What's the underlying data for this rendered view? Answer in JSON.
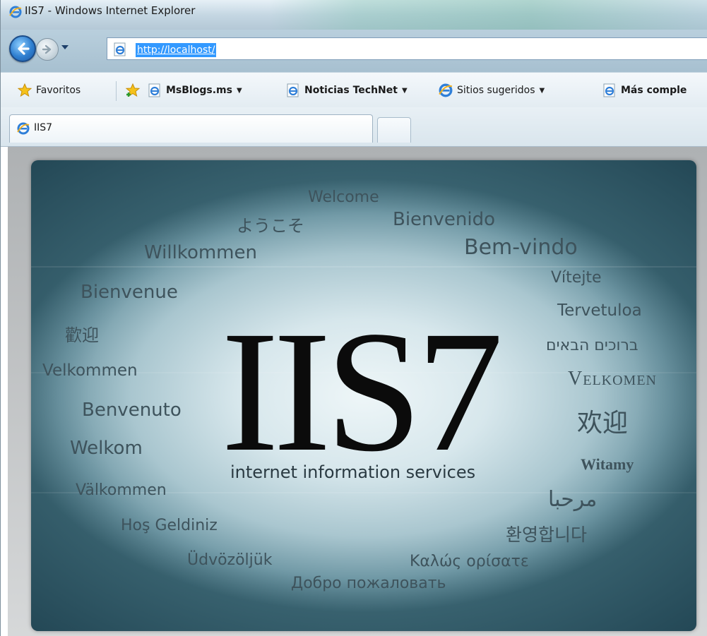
{
  "window": {
    "title": "IIS7 - Windows Internet Explorer"
  },
  "address_bar": {
    "url": "http://localhost/"
  },
  "favorites_bar": {
    "items": [
      {
        "label": "Favoritos",
        "icon": "star-icon"
      },
      {
        "label": "MsBlogs.ms",
        "icon": "ie-page-icon",
        "has_dropdown": true
      },
      {
        "label": "Noticias TechNet",
        "icon": "ie-page-icon",
        "has_dropdown": true
      },
      {
        "label": "Sitios sugeridos",
        "icon": "ie-icon",
        "has_dropdown": true
      },
      {
        "label": "Más comple",
        "icon": "ie-page-icon"
      }
    ]
  },
  "tabs": [
    {
      "label": "IIS7",
      "active": true
    }
  ],
  "page": {
    "logo": "IIS7",
    "subtitle": "internet information services",
    "welcome_words": [
      {
        "text": "Welcome"
      },
      {
        "text": "ようこそ"
      },
      {
        "text": "Bienvenido"
      },
      {
        "text": "Willkommen"
      },
      {
        "text": "Bem-vindo"
      },
      {
        "text": "Vítejte"
      },
      {
        "text": "Bienvenue"
      },
      {
        "text": "Tervetuloa"
      },
      {
        "text": "歡迎"
      },
      {
        "text": "ברוכים הבאים"
      },
      {
        "text": "Velkommen"
      },
      {
        "text": "Velkomen"
      },
      {
        "text": "Benvenuto"
      },
      {
        "text": "欢迎"
      },
      {
        "text": "Welkom"
      },
      {
        "text": "Witamy"
      },
      {
        "text": "Välkommen"
      },
      {
        "text": "مرحبا"
      },
      {
        "text": "Hoş Geldiniz"
      },
      {
        "text": "환영합니다"
      },
      {
        "text": "Üdvözöljük"
      },
      {
        "text": "Καλώς ορίσατε"
      },
      {
        "text": "Добро пожаловать"
      }
    ]
  },
  "colors": {
    "accent_blue": "#3399ff",
    "panel_teal": "#6e97a4",
    "logo_black": "#0b0b0b"
  }
}
